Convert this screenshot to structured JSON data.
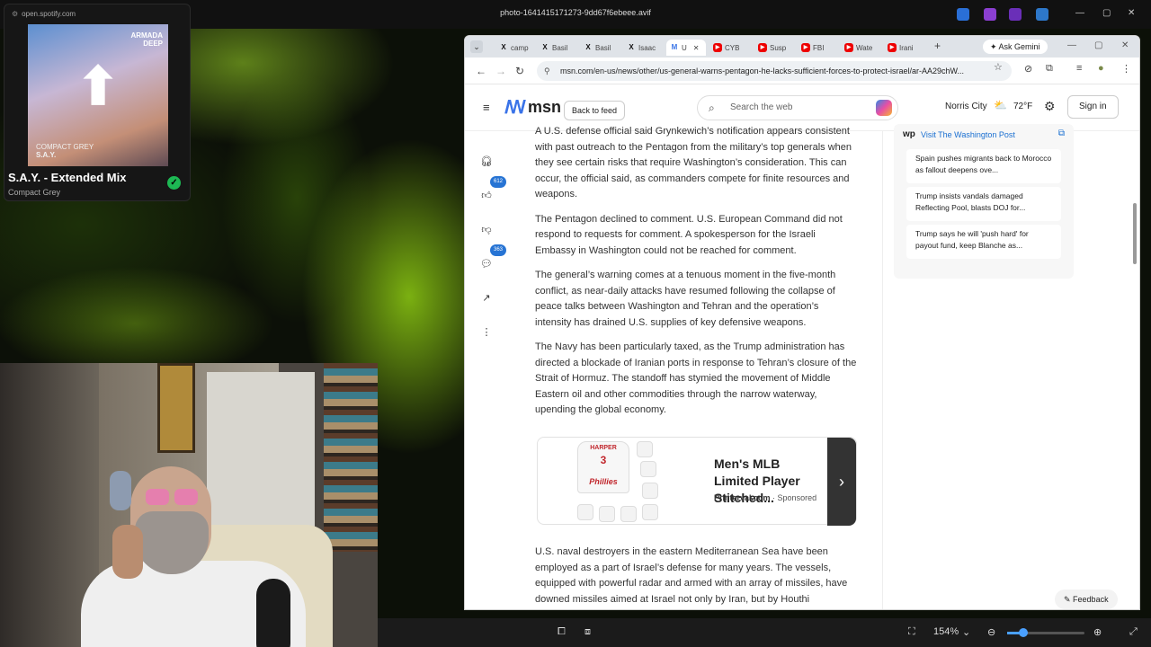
{
  "viewer": {
    "title": "photo-1641415171273-9dd67f6ebeee.avif",
    "zoom": "154%"
  },
  "spotify": {
    "url": "open.spotify.com",
    "album_brand_line1": "ARMADA",
    "album_brand_line2": "DEEP",
    "album_artist": "COMPACT GREY",
    "album_track": "S.A.Y.",
    "track_title": "S.A.Y. - Extended Mix",
    "artist": "Compact Grey"
  },
  "browser": {
    "tabs": [
      {
        "icon": "X",
        "label": "camp",
        "type": "x"
      },
      {
        "icon": "X",
        "label": "Basil",
        "type": "x"
      },
      {
        "icon": "X",
        "label": "Basil",
        "type": "x"
      },
      {
        "icon": "X",
        "label": "Isaac",
        "type": "x"
      },
      {
        "icon": "M",
        "label": "U",
        "type": "msn"
      },
      {
        "icon": "▶",
        "label": "CYB",
        "type": "yt"
      },
      {
        "icon": "▶",
        "label": "Susp",
        "type": "yt"
      },
      {
        "icon": "▶",
        "label": "FBI",
        "type": "yt"
      },
      {
        "icon": "▶",
        "label": "Wate",
        "type": "yt"
      },
      {
        "icon": "▶",
        "label": "Irani",
        "type": "yt"
      }
    ],
    "ask_gemini": "Ask Gemini",
    "url": "msn.com/en-us/news/other/us-general-warns-pentagon-he-lacks-sufficient-forces-to-protect-israel/ar-AA29chW..."
  },
  "msn": {
    "logo": "msn",
    "back_to_feed": "Back to feed",
    "search_placeholder": "Search the web",
    "location": "Norris City",
    "temperature": "72°F",
    "sign_in": "Sign in",
    "likes": "612",
    "comments": "363",
    "paragraphs": [
      "A U.S. defense official said Grynkewich’s notification appears consistent with past outreach to the Pentagon from the military’s top generals when they see certain risks that require Washington’s consideration. This can occur, the official said, as commanders compete for finite resources and weapons.",
      "The Pentagon declined to comment. U.S. European Command did not respond to requests for comment. A spokesperson for the Israeli Embassy in Washington could not be reached for comment.",
      "The general’s warning comes at a tenuous moment in the five-month conflict, as near-daily attacks have resumed following the collapse of peace talks between Washington and Tehran and the operation’s intensity has drained U.S. supplies of key defensive weapons.",
      "The Navy has been particularly taxed, as the Trump administration has directed a blockade of Iranian ports in response to Tehran’s closure of the Strait of Hormuz. The standoff has stymied the movement of Middle Eastern oil and other commodities through the narrow waterway, upending the global economy."
    ],
    "paragraph_after_ad": "U.S. naval destroyers in the eastern Mediterranean Sea have been employed as a part of Israel’s defense for many years. The vessels, equipped with powerful radar and armed with an array of missiles, have downed missiles aimed at Israel not only by Iran, but by Houthi",
    "ad": {
      "title": "Men's MLB Limited Player Stitched...",
      "source": "Printerval.com",
      "sponsored": "· Sponsored",
      "jersey_name": "HARPER",
      "jersey_number": "3",
      "jersey_brand": "Phillies"
    },
    "sidebar": {
      "wp_logo": "wp",
      "visit_link": "Visit The Washington Post",
      "headlines": [
        "Spain pushes migrants back to Morocco as fallout deepens ove...",
        "Trump insists vandals damaged Reflecting Pool, blasts DOJ for...",
        "Trump says he will 'push hard' for payout fund, keep Blanche as..."
      ]
    },
    "feedback": "Feedback"
  }
}
